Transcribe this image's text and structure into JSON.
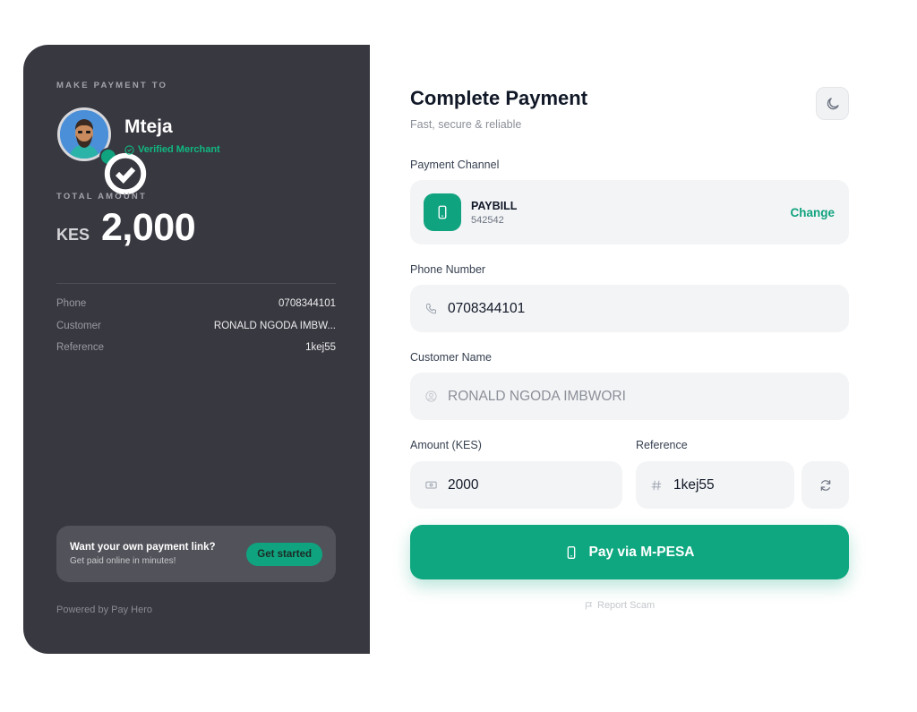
{
  "merchant": {
    "eyebrow": "MAKE PAYMENT TO",
    "name": "Mteja",
    "verified_label": "Verified Merchant"
  },
  "total": {
    "eyebrow": "TOTAL AMOUNT",
    "currency": "KES",
    "amount": "2,000"
  },
  "details": [
    {
      "label": "Phone",
      "value": "0708344101"
    },
    {
      "label": "Customer",
      "value": "RONALD NGODA IMBW..."
    },
    {
      "label": "Reference",
      "value": "1kej55"
    }
  ],
  "promo": {
    "title": "Want your own payment link?",
    "subtitle": "Get paid online in minutes!",
    "button": "Get started"
  },
  "powered_by": "Powered by Pay Hero",
  "form": {
    "title": "Complete Payment",
    "subtitle": "Fast, secure & reliable",
    "channel_label": "Payment Channel",
    "channel_name": "PAYBILL",
    "channel_number": "542542",
    "change_label": "Change",
    "phone_label": "Phone Number",
    "phone_value": "0708344101",
    "customer_label": "Customer Name",
    "customer_value": "RONALD NGODA IMBWORI",
    "amount_label": "Amount (KES)",
    "amount_value": "2000",
    "reference_label": "Reference",
    "reference_value": "1kej55",
    "pay_button": "Pay via M-PESA",
    "report_label": "Report Scam"
  },
  "colors": {
    "panel": "#383840",
    "accent": "#10a37f",
    "field_bg": "#f3f4f6"
  },
  "icons": [
    "merchant-avatar",
    "verified-check-icon",
    "moon-icon",
    "phone-device-icon",
    "phone-handset-icon",
    "user-circle-icon",
    "cash-icon",
    "hash-icon",
    "refresh-icon",
    "flag-icon"
  ]
}
